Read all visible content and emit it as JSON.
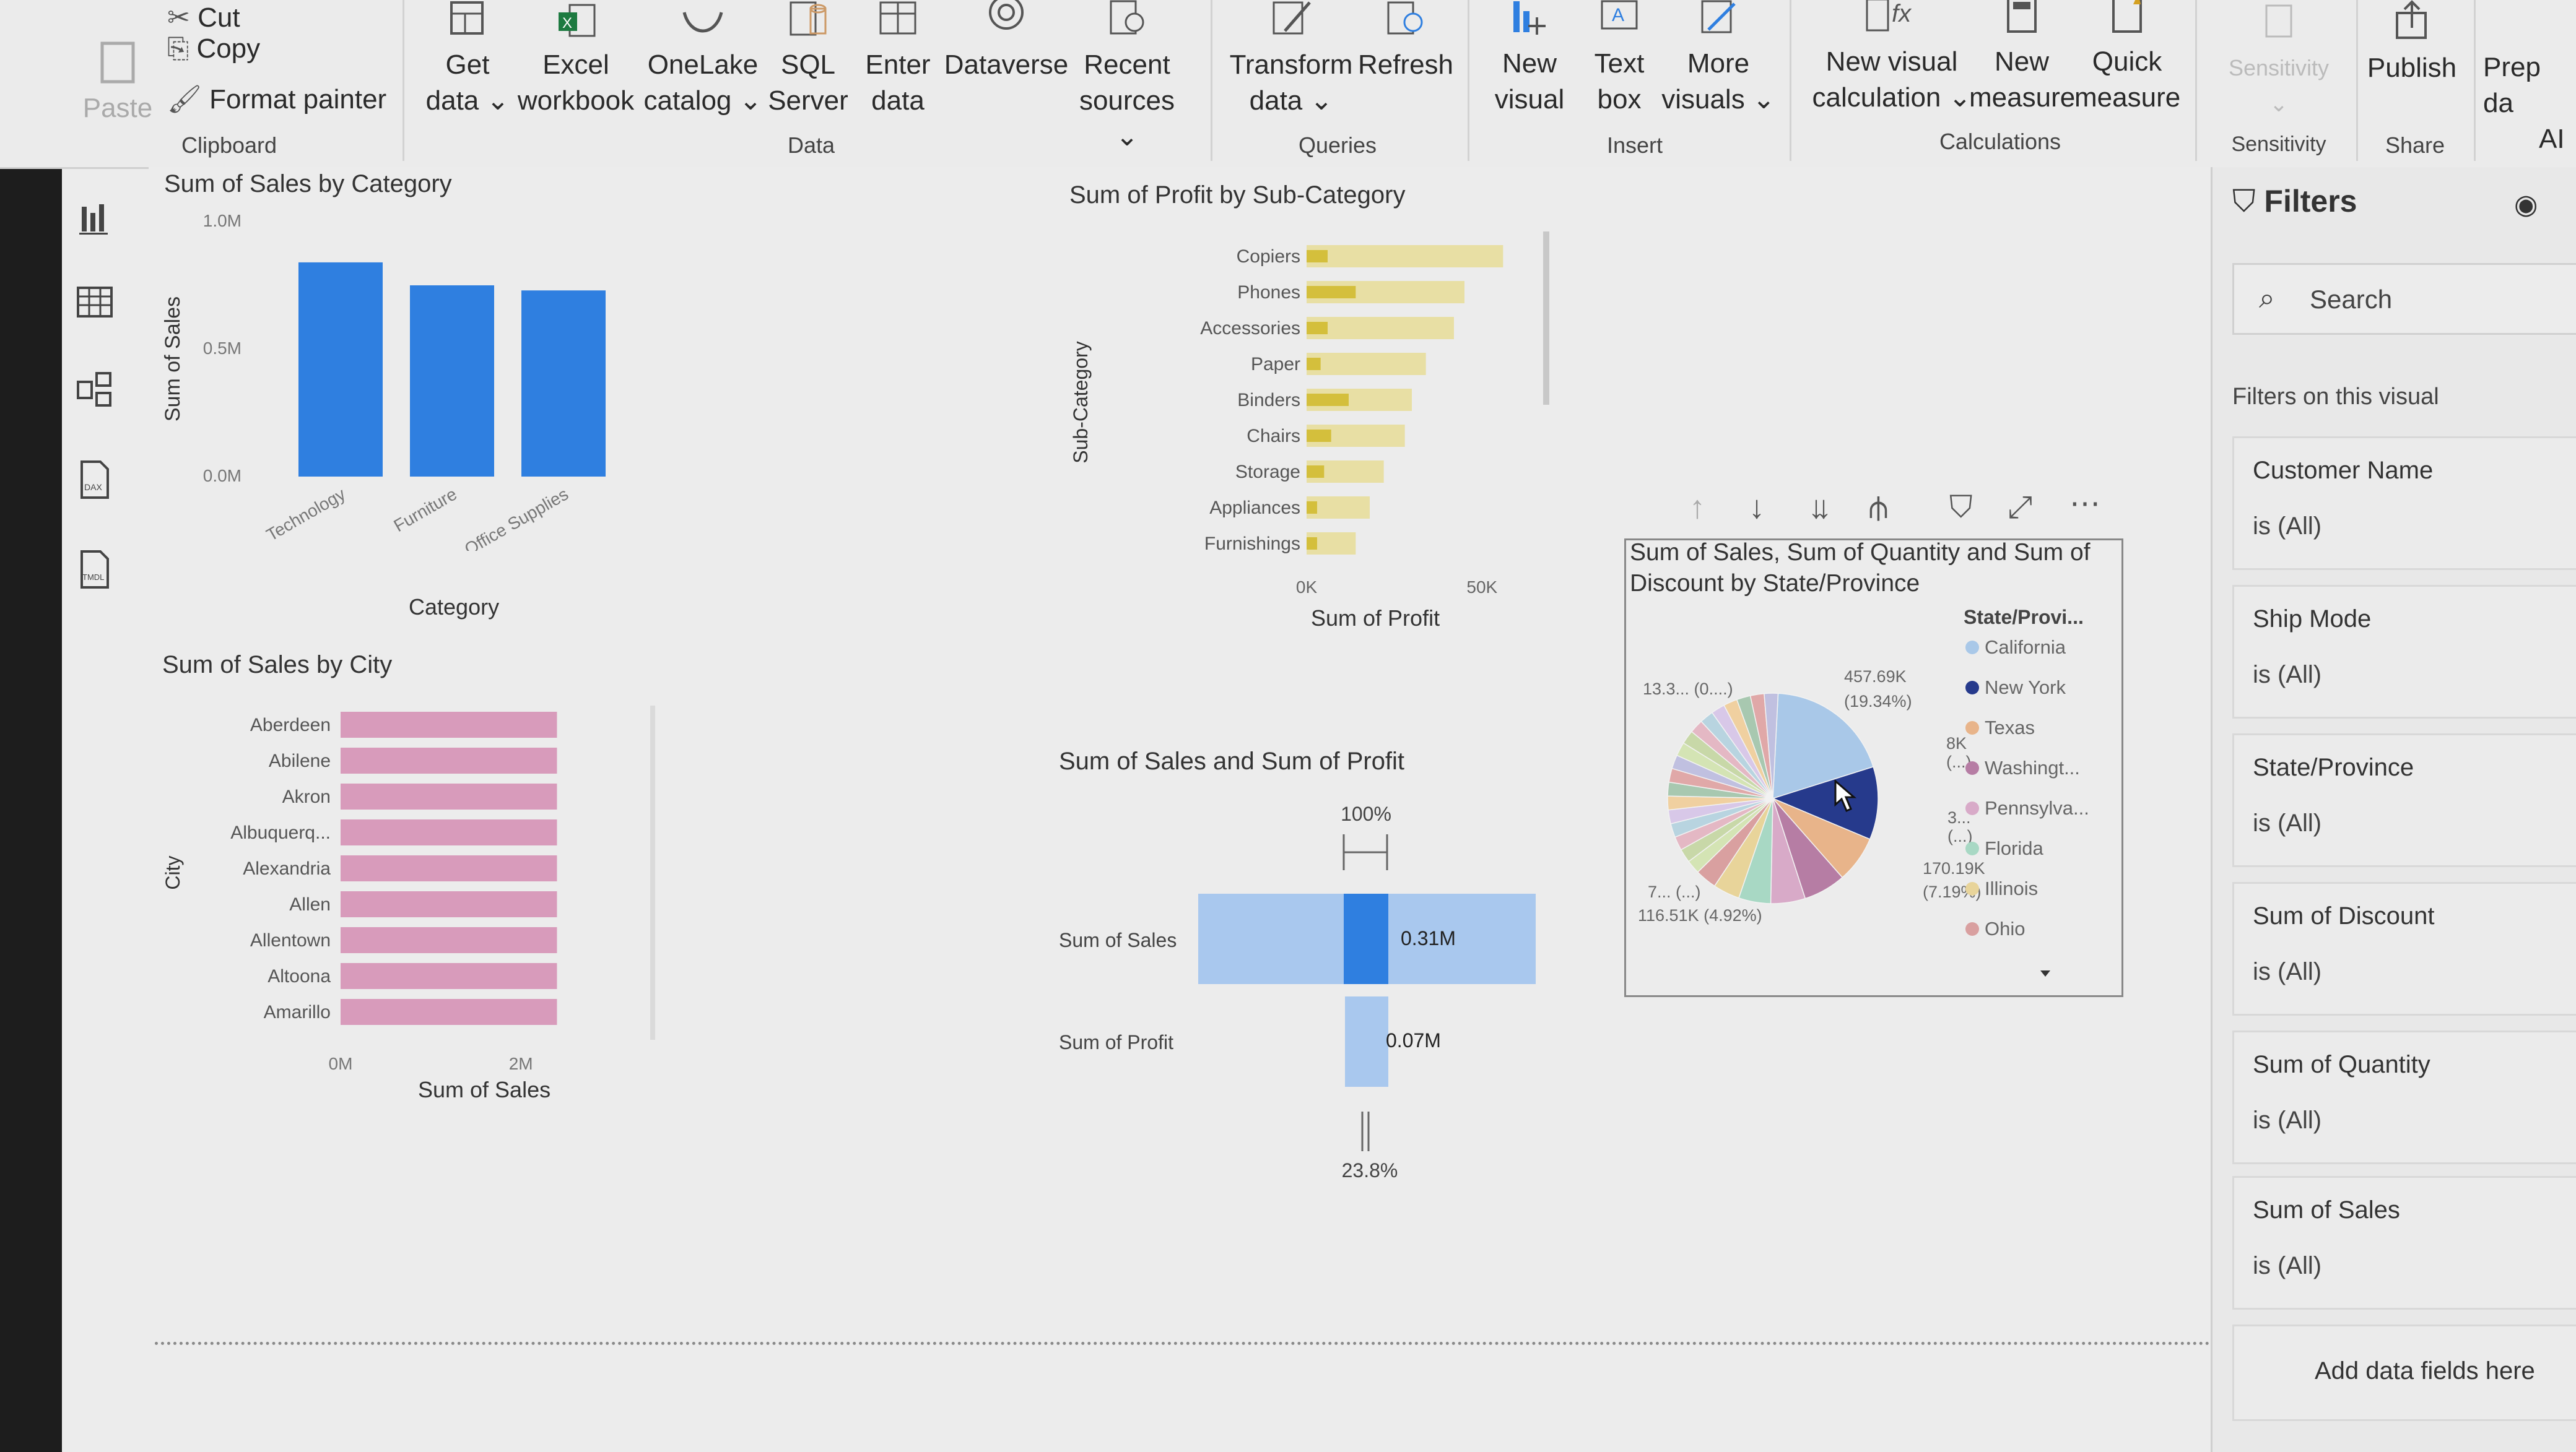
{
  "ribbon": {
    "clipboard": {
      "paste": "Paste",
      "cut": "Cut",
      "copy": "Copy",
      "format_painter": "Format painter",
      "group": "Clipboard"
    },
    "data": {
      "get_data": "Get",
      "get_data2": "data",
      "excel": "Excel",
      "excel2": "workbook",
      "onelake": "OneLake",
      "onelake2": "catalog",
      "sql": "SQL",
      "sql2": "Server",
      "enter": "Enter",
      "enter2": "data",
      "dataverse": "Dataverse",
      "recent": "Recent",
      "recent2": "sources",
      "group": "Data"
    },
    "queries": {
      "transform": "Transform",
      "transform2": "data",
      "refresh": "Refresh",
      "group": "Queries"
    },
    "insert": {
      "new_visual": "New",
      "new_visual2": "visual",
      "text_box": "Text",
      "text_box2": "box",
      "more_visuals": "More",
      "more_visuals2": "visuals",
      "group": "Insert"
    },
    "calculations": {
      "new_visual_calc": "New visual",
      "new_visual_calc2": "calculation",
      "new_measure": "New",
      "new_measure2": "measure",
      "quick_measure": "Quick",
      "quick_measure2": "measure",
      "group": "Calculations"
    },
    "sensitivity": {
      "label": "Sensitivity",
      "group": "Sensitivity"
    },
    "share": {
      "publish": "Publish",
      "group": "Share"
    },
    "prep": {
      "label": "Prep da",
      "label2": "AI"
    }
  },
  "chart_data": [
    {
      "type": "bar",
      "title": "Sum of Sales by Category",
      "xlabel": "Category",
      "ylabel": "Sum of Sales",
      "categories": [
        "Technology",
        "Furniture",
        "Office Supplies"
      ],
      "values": [
        0.84,
        0.75,
        0.73
      ],
      "ylim": [
        0,
        1.0
      ],
      "yticks": [
        "1.0M",
        "0.5M",
        "0.0M"
      ],
      "color": "#2f7fe0"
    },
    {
      "type": "bar",
      "title": "Sum of Profit by Sub-Category",
      "xlabel": "Sum of Profit",
      "ylabel": "Sub-Category",
      "categories": [
        "Copiers",
        "Phones",
        "Accessories",
        "Paper",
        "Binders",
        "Chairs",
        "Storage",
        "Appliances",
        "Furnishings"
      ],
      "values": [
        56,
        45,
        42,
        34,
        30,
        28,
        22,
        18,
        14
      ],
      "overlay_values": [
        6,
        14,
        6,
        4,
        12,
        7,
        5,
        3,
        3
      ],
      "xlim": [
        0,
        60
      ],
      "xticks": [
        "0K",
        "50K"
      ],
      "color": "#e8dfa4",
      "overlay_color": "#d4bf3c"
    },
    {
      "type": "bar",
      "title": "Sum of Sales by City",
      "xlabel": "Sum of Sales",
      "ylabel": "City",
      "categories": [
        "Aberdeen",
        "Abilene",
        "Akron",
        "Albuquerq...",
        "Alexandria",
        "Allen",
        "Allentown",
        "Altoona",
        "Amarillo"
      ],
      "values": [
        2.4,
        2.4,
        2.4,
        2.4,
        2.4,
        2.4,
        2.4,
        2.4,
        2.4
      ],
      "xticks": [
        "0M",
        "2M"
      ],
      "color": "#d89bbb"
    },
    {
      "type": "bar",
      "title": "Sum of Sales and Sum of Profit",
      "categories": [
        "Sum of Sales",
        "Sum of Profit"
      ],
      "value_labels": [
        "0.31M",
        "0.07M"
      ],
      "top_label": "100%",
      "bottom_label": "23.8%"
    },
    {
      "type": "pie",
      "title": "Sum of Sales, Sum of Quantity and Sum of Discount by State/Province",
      "legend_title": "State/Provi...",
      "legend_position": "right",
      "categories": [
        "California",
        "New York",
        "Texas",
        "Washingt...",
        "Pennsylva...",
        "Florida",
        "Illinois",
        "Ohio"
      ],
      "colors": [
        "#a9c8e8",
        "#263a8c",
        "#e8b48a",
        "#b67da4",
        "#d8aac8",
        "#a8d8c4",
        "#e8d49a",
        "#d9a0a0"
      ],
      "data_labels": [
        "457.69K",
        "(19.34%)",
        "8K",
        "(...)",
        "3...",
        "(...)",
        "170.19K",
        "(7.19%)",
        "116.51K (4.92%)",
        "7... (...)",
        "13.3... (0....)"
      ]
    }
  ],
  "filters": {
    "title": "Filters",
    "search_placeholder": "Search",
    "section": "Filters on this visual",
    "cards": [
      {
        "name": "Customer Name",
        "value": "is (All)"
      },
      {
        "name": "Ship Mode",
        "value": "is (All)"
      },
      {
        "name": "State/Province",
        "value": "is (All)"
      },
      {
        "name": "Sum of Discount",
        "value": "is (All)"
      },
      {
        "name": "Sum of Quantity",
        "value": "is (All)"
      },
      {
        "name": "Sum of Sales",
        "value": "is (All)"
      }
    ],
    "add_fields": "Add data fields here"
  }
}
